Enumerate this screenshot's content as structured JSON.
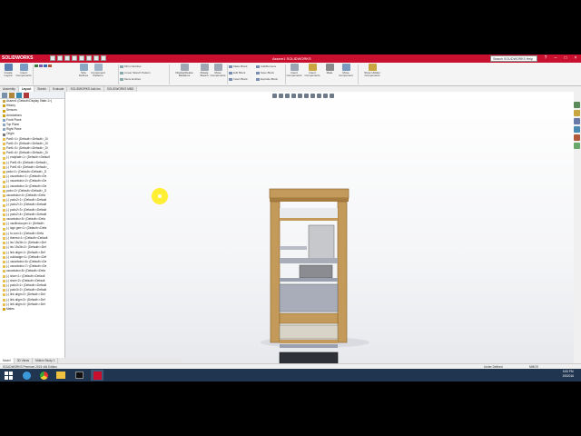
{
  "app": {
    "logo": "SOLIDWORKS",
    "doc_title": "Assem1 SOLIDWORKS",
    "search_placeholder": "Search SOLIDWORKS Help"
  },
  "window_buttons": [
    "?",
    "–",
    "□",
    "×"
  ],
  "ribbon": {
    "buttons": [
      {
        "label": "Create Layout",
        "icon": "layout-icon"
      },
      {
        "label": "Insert Components",
        "icon": "insert-components-icon"
      },
      {
        "label": "Size Defines",
        "icon": "size-defines-icon"
      },
      {
        "label": "Component Patterns",
        "icon": "pattern-icon"
      },
      {
        "label": "Display/Delete Relations",
        "icon": "relations-icon"
      },
      {
        "label": "Rotate Sketch",
        "icon": "rotate-icon"
      },
      {
        "label": "Move Components",
        "icon": "move-icon"
      },
      {
        "label": "Insert Components",
        "icon": "insert-icon"
      },
      {
        "label": "Mate",
        "icon": "mate-icon"
      },
      {
        "label": "Move Component",
        "icon": "move-component-icon"
      },
      {
        "label": "Show Hidden Components",
        "icon": "show-hidden-icon"
      }
    ],
    "small_items": [
      "Mirror Entities",
      "Linear Sketch Pattern",
      "Move Entities",
      "Make Block",
      "Edit Block",
      "Insert Block",
      "Add/Remove",
      "Save Block",
      "Explode Block"
    ]
  },
  "tabs": [
    "Assembly",
    "Layout",
    "Sketch",
    "Evaluate",
    "SOLIDWORKS Add-Ins",
    "SOLIDWORKS MBD"
  ],
  "active_tab": "Layout",
  "tree": {
    "root": "Assem1 (Default<Display State-1>)",
    "items": [
      {
        "label": "History",
        "type": "folder"
      },
      {
        "label": "Sensors",
        "type": "folder"
      },
      {
        "label": "Annotations",
        "type": "folder"
      },
      {
        "label": "Front Plane",
        "type": "plane"
      },
      {
        "label": "Top Plane",
        "type": "plane"
      },
      {
        "label": "Right Plane",
        "type": "plane"
      },
      {
        "label": "Origin",
        "type": "origin"
      },
      {
        "label": "Part1<1> (Default<<Default>_Di",
        "type": "part"
      },
      {
        "label": "Part1<2> (Default<<Default>_Di",
        "type": "part"
      },
      {
        "label": "Part1<3> (Default<<Default>_Di",
        "type": "part"
      },
      {
        "label": "Part1<4> (Default<<Default>_Di",
        "type": "part"
      },
      {
        "label": "(-) endplate<1> (Default<<Default",
        "type": "part"
      },
      {
        "label": "(-) Part1<5> (Default<<Default>_",
        "type": "part"
      },
      {
        "label": "(-) Part1<6> (Default<<Default>_",
        "type": "part"
      },
      {
        "label": "pcdo<1> (Default<<Default>_D",
        "type": "part"
      },
      {
        "label": "(-) oscarbobo<1> (Default<<De",
        "type": "part"
      },
      {
        "label": "(-) oscarbobo<2> (Default<<De",
        "type": "part"
      },
      {
        "label": "(-) oscarbobo<3> (Default<<De",
        "type": "part"
      },
      {
        "label": "pcdo<2> (Default<<Default>_D",
        "type": "part"
      },
      {
        "label": "oscarbobo<4> (Default<<Defa",
        "type": "part"
      },
      {
        "label": "(-) pcdo2<1> (Default<<Default",
        "type": "part"
      },
      {
        "label": "(-) pcdo2<2> (Default<<Default",
        "type": "part"
      },
      {
        "label": "(-) pcdo2<3> (Default<<Default",
        "type": "part"
      },
      {
        "label": "(-) pcdo2<4> (Default<<Default",
        "type": "part"
      },
      {
        "label": "oscarbobo<5> (Default<<Defa",
        "type": "part"
      },
      {
        "label": "(-) oscillroscope<1> (Default<",
        "type": "part"
      },
      {
        "label": "(-) sign gen<1> (Default<<Defa",
        "type": "part"
      },
      {
        "label": "(-) to con<1> (Default<<Defa",
        "type": "part"
      },
      {
        "label": "(-) thermo<1> (Default<<Default",
        "type": "part"
      },
      {
        "label": "(-) lec 15v3k<1> (Default<<Def",
        "type": "part"
      },
      {
        "label": "(-) lec 15v3k<2> (Default<<Def",
        "type": "part"
      },
      {
        "label": "(-) link align<1> (Default<<Def",
        "type": "part"
      },
      {
        "label": "(-) cukbadge<1> (Default<<Def",
        "type": "part"
      },
      {
        "label": "(-) oscarbobo<6> (Default<<De",
        "type": "part"
      },
      {
        "label": "(-) oscarbobo<7> (Default<<De",
        "type": "part"
      },
      {
        "label": "oscarbobo<8> (Default<<Defa",
        "type": "part"
      },
      {
        "label": "(-) shoe<1> (Default<<Default",
        "type": "part"
      },
      {
        "label": "(-) shoe<2> (Default<<Default",
        "type": "part"
      },
      {
        "label": "(-) pcdo3<1> (Default<<Default",
        "type": "part"
      },
      {
        "label": "(-) pcdo3<2> (Default<<Default",
        "type": "part"
      },
      {
        "label": "(-) link align<2> (Default<<Def",
        "type": "part"
      },
      {
        "label": "(-) link align<3> (Default<<Def",
        "type": "part"
      },
      {
        "label": "(-) link align<4> (Default<<Def",
        "type": "part"
      },
      {
        "label": "Mates",
        "type": "folder"
      }
    ]
  },
  "bottom_tabs": [
    "Model",
    "3D Views",
    "Motion Study 1"
  ],
  "active_bottom_tab": "Model",
  "status": {
    "left": "SOLIDWORKS Premium 2015 x64 Edition",
    "middle": "Under Defined",
    "units": "MMGS"
  },
  "clock": {
    "time": "5:53 PM",
    "date": "2/5/2016"
  },
  "colors": {
    "wood": "#c49a5a",
    "wood_dark": "#8f6a33",
    "shelf_metal": "#b8bcc6",
    "accent": "#c8102e"
  }
}
